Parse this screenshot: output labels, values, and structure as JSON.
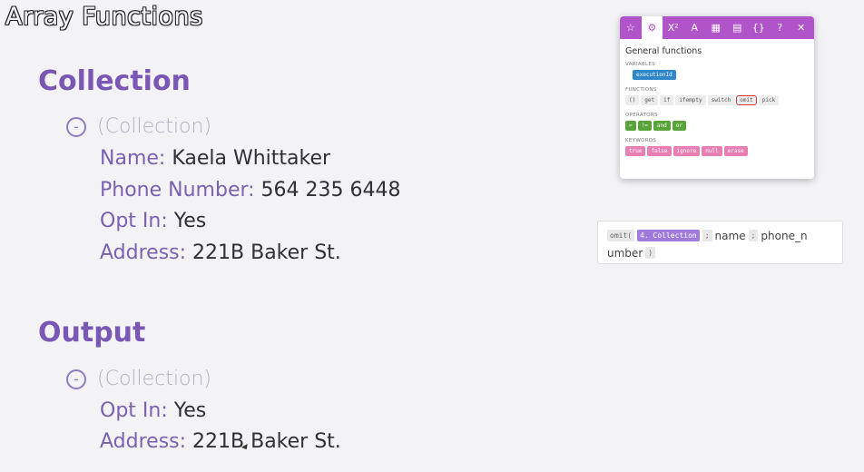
{
  "page": {
    "title": "Array Functions"
  },
  "collection": {
    "heading": "Collection",
    "toggle_icon": "-",
    "label": "(Collection)",
    "fields": [
      {
        "key": "Name:",
        "value": "Kaela Whittaker"
      },
      {
        "key": "Phone Number:",
        "value": "564 235 6448"
      },
      {
        "key": "Opt In:",
        "value": "Yes"
      },
      {
        "key": "Address:",
        "value": "221B Baker St."
      }
    ]
  },
  "output": {
    "heading": "Output",
    "toggle_icon": "-",
    "label": "(Collection)",
    "fields": [
      {
        "key": "Opt In:",
        "value": "Yes"
      },
      {
        "key": "Address:",
        "value": "221B Baker St."
      }
    ]
  },
  "picker": {
    "tabs": [
      {
        "icon": "star-icon",
        "glyph": "☆"
      },
      {
        "icon": "gear-icon",
        "glyph": "⚙"
      },
      {
        "icon": "superscript-icon",
        "glyph": "X²"
      },
      {
        "icon": "text-icon",
        "glyph": "A"
      },
      {
        "icon": "calendar-icon",
        "glyph": "▦"
      },
      {
        "icon": "table-icon",
        "glyph": "▤"
      },
      {
        "icon": "braces-icon",
        "glyph": "{}"
      },
      {
        "icon": "help-icon",
        "glyph": "?"
      },
      {
        "icon": "close-icon",
        "glyph": "✕"
      }
    ],
    "heading": "General functions",
    "variables_label": "VARIABLES",
    "variables": [
      "executionId"
    ],
    "functions_label": "FUNCTIONS",
    "functions": [
      "()",
      "get",
      "if",
      "ifempty",
      "switch",
      "omit",
      "pick"
    ],
    "highlighted_function": "omit",
    "operators_label": "OPERATORS",
    "operators": [
      "=",
      "!=",
      "and",
      "or"
    ],
    "keywords_label": "KEYWORDS",
    "keywords": [
      "true",
      "false",
      "ignore",
      "null",
      "erase"
    ]
  },
  "formula": {
    "fn_open": "omit(",
    "collection_token": "4. Collection",
    "sep1": ";",
    "arg1": "name",
    "sep2": ";",
    "arg2_part1": "phone_n",
    "arg2_part2": "umber",
    "fn_close": ")"
  }
}
